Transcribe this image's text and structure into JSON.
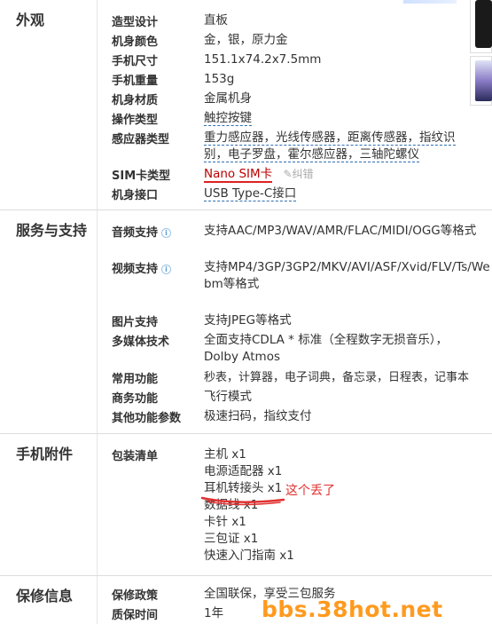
{
  "sections": {
    "appearance": {
      "title": "外观",
      "rows": [
        {
          "label": "造型设计",
          "value": "直板"
        },
        {
          "label": "机身颜色",
          "value": "金，银，原力金"
        },
        {
          "label": "手机尺寸",
          "value": "151.1x74.2x7.5mm"
        },
        {
          "label": "手机重量",
          "value": "153g"
        },
        {
          "label": "机身材质",
          "value": "金属机身"
        },
        {
          "label": "操作类型",
          "value": "触控按键"
        },
        {
          "label": "感应器类型",
          "value": "重力感应器，光线传感器，距离传感器，指纹识别，电子罗盘，霍尔感应器，三轴陀螺仪"
        },
        {
          "label": "SIM卡类型",
          "value": "Nano SIM卡",
          "extra": "纠错"
        },
        {
          "label": "机身接口",
          "value": "USB Type-C接口"
        }
      ]
    },
    "service": {
      "title": "服务与支持",
      "rows": [
        {
          "label": "音频支持",
          "value": "支持AAC/MP3/WAV/AMR/FLAC/MIDI/OGG等格式"
        },
        {
          "label": "视频支持",
          "value": "支持MP4/3GP/3GP2/MKV/AVI/ASF/Xvid/FLV/Ts/Webm等格式"
        },
        {
          "label": "图片支持",
          "value": "支持JPEG等格式"
        },
        {
          "label": "多媒体技术",
          "value": "全面支持CDLA * 标准（全程数字无损音乐）， Dolby Atmos"
        },
        {
          "label": "常用功能",
          "value": "秒表，计算器，电子词典，备忘录，日程表，记事本"
        },
        {
          "label": "商务功能",
          "value": "飞行模式"
        },
        {
          "label": "其他功能参数",
          "value": "极速扫码，指纹支付"
        }
      ]
    },
    "accessories": {
      "title": "手机附件",
      "label": "包装清单",
      "items": [
        "主机 x1",
        "电源适配器 x1",
        "耳机转接头 x1",
        "数据线 x1",
        "卡针 x1",
        "三包证 x1",
        "快速入门指南 x1"
      ],
      "note": "这个丢了"
    },
    "warranty": {
      "title": "保修信息",
      "rows": [
        {
          "label": "保修政策",
          "value": "全国联保，享受三包服务"
        },
        {
          "label": "质保时间",
          "value": "1年"
        }
      ]
    }
  },
  "watermark": "bbs.38hot.net",
  "colors": {
    "annotation": "#e03030",
    "watermark": "#ff9a1f",
    "link_dash": "#2f6fb0"
  }
}
